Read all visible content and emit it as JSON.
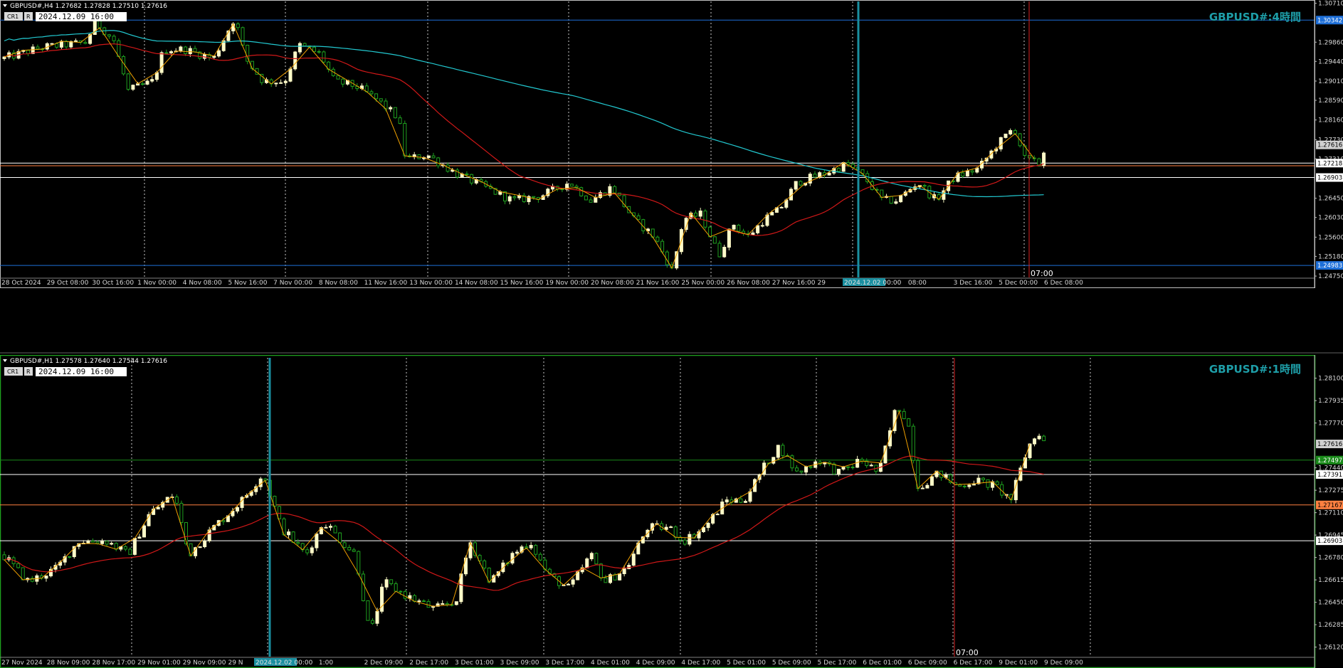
{
  "panels": [
    {
      "id": "h4",
      "header": "GBPUSD#,H4  1.27682 1.27828 1.27510 1.27616",
      "btn1": "CR1",
      "btn2": "R",
      "stamp": "2024.12.09 16:00",
      "watermark": "GBPUSD#:4時間",
      "price_labels": [
        "1.30710",
        "1.30342",
        "1.29860",
        "1.29440",
        "1.29010",
        "1.28590",
        "1.28160",
        "1.27730",
        "1.27616",
        "1.27310",
        "1.27218",
        "1.26903",
        "1.26450",
        "1.26030",
        "1.25600",
        "1.25180",
        "1.24983",
        "1.24750"
      ],
      "x_labels": [
        "28 Oct 2024",
        "29 Oct 08:00",
        "30 Oct 16:00",
        "1 Nov 00:00",
        "4 Nov 08:00",
        "5 Nov 16:00",
        "7 Nov 00:00",
        "8 Nov 08:00",
        "11 Nov 16:00",
        "13 Nov 00:00",
        "14 Nov 08:00",
        "15 Nov 16:00",
        "19 Nov 00:00",
        "20 Nov 08:00",
        "21 Nov 16:00",
        "25 Nov 00:00",
        "26 Nov 08:00",
        "27 Nov 16:00",
        "29",
        "2024.12.02 00:00",
        "08:00",
        "3 Dec 16:00",
        "5 Dec 00:00",
        "6 Dec 08:00"
      ],
      "cursor_time": "07:00",
      "levels": [
        {
          "price": 1.30342,
          "color": "#1e6fd8",
          "tag": "1.30342"
        },
        {
          "price": 1.27218,
          "color": "#ffffff",
          "tag": "1.27218"
        },
        {
          "price": 1.2716,
          "color": "#ff8040",
          "tag": ""
        },
        {
          "price": 1.26903,
          "color": "#ffffff",
          "tag": "1.26903"
        },
        {
          "price": 1.24983,
          "color": "#1e6fd8",
          "tag": "1.24983"
        }
      ],
      "current_price": "1.27616"
    },
    {
      "id": "h1",
      "header": "GBPUSD#,H1  1.27578 1.27640 1.27544 1.27616",
      "btn1": "CR1",
      "btn2": "R",
      "stamp": "2024.12.09 16:00",
      "watermark": "GBPUSD#:1時間",
      "price_labels": [
        "1.28100",
        "1.27935",
        "1.27770",
        "1.27616",
        "1.27497",
        "1.27440",
        "1.27391",
        "1.27275",
        "1.27167",
        "1.27110",
        "1.26945",
        "1.26903",
        "1.26780",
        "1.26615",
        "1.26450",
        "1.26285",
        "1.26120"
      ],
      "x_labels": [
        "27 Nov 2024",
        "28 Nov 09:00",
        "28 Nov 17:00",
        "29 Nov 01:00",
        "29 Nov 09:00",
        "29 N",
        "2024.12.02 00:00",
        "1:00",
        "2 Dec 09:00",
        "2 Dec 17:00",
        "3 Dec 01:00",
        "3 Dec 09:00",
        "3 Dec 17:00",
        "4 Dec 01:00",
        "4 Dec 09:00",
        "4 Dec 17:00",
        "5 Dec 01:00",
        "5 Dec 09:00",
        "5 Dec 17:00",
        "6 Dec 01:00",
        "6 Dec 09:00",
        "6 Dec 17:00",
        "9 Dec 01:00",
        "9 Dec 09:00"
      ],
      "cursor_time": "07:00",
      "levels": [
        {
          "price": 1.27497,
          "color": "#1a8a1a",
          "tag": "1.27497"
        },
        {
          "price": 1.27391,
          "color": "#ffffff",
          "tag": "1.27391"
        },
        {
          "price": 1.27167,
          "color": "#ff8040",
          "tag": "1.27167"
        },
        {
          "price": 1.26903,
          "color": "#ffffff",
          "tag": "1.26903"
        }
      ],
      "current_price": "1.27616"
    }
  ],
  "chart_data": [
    {
      "type": "candlestick",
      "symbol": "GBPUSD#",
      "timeframe": "H4",
      "title": "GBPUSD#:4時間",
      "ylim": [
        1.2472,
        1.3075
      ],
      "x_range": [
        "28 Oct 2024",
        "9 Dec 2024"
      ],
      "last_ohlc": {
        "open": 1.27682,
        "high": 1.27828,
        "low": 1.2751,
        "close": 1.27616
      },
      "series": [
        {
          "color": "#00c8d0",
          "points": [
            [
              0,
              1.304
            ],
            [
              160,
              1.301
            ],
            [
              320,
              1.299
            ],
            [
              500,
              1.296
            ],
            [
              700,
              1.2895
            ],
            [
              900,
              1.283
            ],
            [
              1000,
              1.278
            ],
            [
              1100,
              1.274
            ],
            [
              1200,
              1.27
            ],
            [
              1280,
              1.267
            ],
            [
              1350,
              1.265
            ],
            [
              1420,
              1.262
            ],
            [
              1520,
              1.26
            ],
            [
              1620,
              1.257
            ],
            [
              1700,
              1.258
            ],
            [
              1800,
              1.262
            ],
            [
              1900,
              1.268
            ],
            [
              2000,
              1.274
            ],
            [
              2100,
              1.272
            ],
            [
              2200,
              1.27
            ]
          ]
        },
        {
          "color": "#d01010",
          "points": [
            [
              0,
              1.297
            ],
            [
              160,
              1.299
            ],
            [
              320,
              1.295
            ],
            [
              500,
              1.296
            ],
            [
              700,
              1.292
            ],
            [
              900,
              1.278
            ],
            [
              1000,
              1.27
            ],
            [
              1100,
              1.265
            ],
            [
              1200,
              1.262
            ],
            [
              1280,
              1.26
            ],
            [
              1350,
              1.259
            ],
            [
              1420,
              1.258
            ],
            [
              1520,
              1.257
            ],
            [
              1620,
              1.256
            ],
            [
              1700,
              1.258
            ],
            [
              1800,
              1.262
            ],
            [
              1900,
              1.266
            ],
            [
              2000,
              1.27
            ],
            [
              2100,
              1.272
            ],
            [
              2200,
              1.273
            ]
          ]
        }
      ]
    },
    {
      "type": "candlestick",
      "symbol": "GBPUSD#",
      "timeframe": "H1",
      "title": "GBPUSD#:1時間",
      "ylim": [
        1.2605,
        1.2825
      ],
      "x_range": [
        "27 Nov 2024",
        "9 Dec 2024"
      ],
      "last_ohlc": {
        "open": 1.27578,
        "high": 1.2764,
        "low": 1.27544,
        "close": 1.27616
      }
    }
  ]
}
